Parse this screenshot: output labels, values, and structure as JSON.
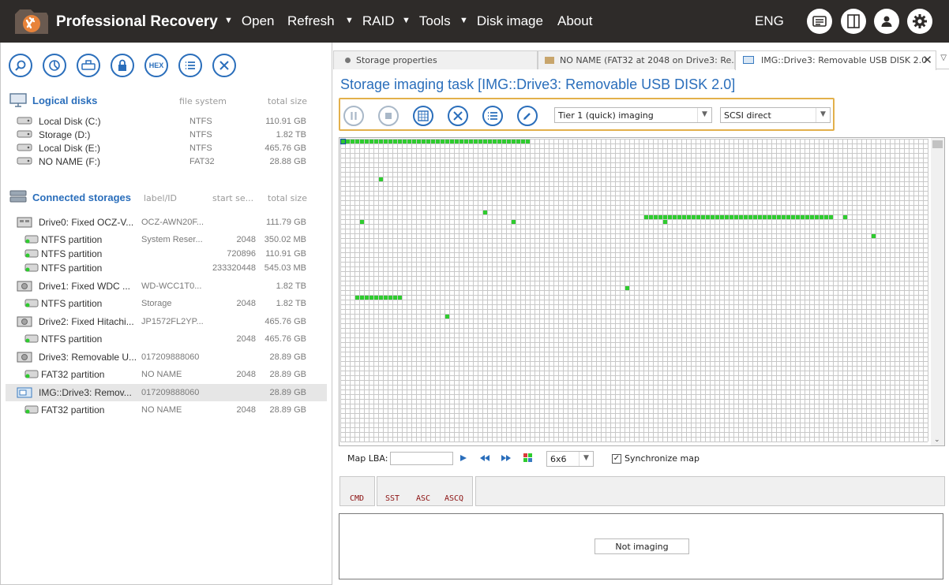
{
  "app": {
    "title": "Professional Recovery",
    "menu": [
      {
        "label": "Open",
        "has_arrow": true
      },
      {
        "label": "Refresh",
        "has_arrow": false
      },
      {
        "label": "RAID",
        "has_arrow": true
      },
      {
        "label": "Tools",
        "has_arrow": true
      },
      {
        "label": "Disk image",
        "has_arrow": true
      },
      {
        "label": "About",
        "has_arrow": false
      }
    ],
    "language": "ENG",
    "top_icons": [
      "log-icon",
      "panel-toggle-icon",
      "user-icon",
      "settings-icon"
    ]
  },
  "left_toolbar": {
    "buttons": [
      "search-icon",
      "scan-icon",
      "image-file-icon",
      "lock-icon",
      "hex-icon",
      "list-icon",
      "close-icon"
    ],
    "hex_label": "HEX"
  },
  "logical_disks": {
    "title": "Logical disks",
    "col_fs": "file system",
    "col_size": "total size",
    "items": [
      {
        "name": "Local Disk (C:)",
        "fs": "NTFS",
        "size": "110.91 GB"
      },
      {
        "name": "Storage (D:)",
        "fs": "NTFS",
        "size": "1.82 TB"
      },
      {
        "name": "Local Disk (E:)",
        "fs": "NTFS",
        "size": "465.76 GB"
      },
      {
        "name": "NO NAME (F:)",
        "fs": "FAT32",
        "size": "28.88 GB"
      }
    ]
  },
  "connected_storages": {
    "title": "Connected storages",
    "col_label": "label/ID",
    "col_start": "start se...",
    "col_size": "total size",
    "items": [
      {
        "kind": "drive",
        "icon": "ssd-icon",
        "name": "Drive0: Fixed OCZ-V...",
        "label": "OCZ-AWN20F...",
        "start": "",
        "size": "111.79 GB"
      },
      {
        "kind": "partition",
        "name": "NTFS partition",
        "label": "System Reser...",
        "start": "2048",
        "size": "350.02 MB"
      },
      {
        "kind": "partition",
        "name": "NTFS partition",
        "label": "",
        "start": "720896",
        "size": "110.91 GB"
      },
      {
        "kind": "partition",
        "name": "NTFS partition",
        "label": "",
        "start": "233320448",
        "size": "545.03 MB"
      },
      {
        "kind": "drive",
        "icon": "hdd-icon",
        "name": "Drive1: Fixed WDC ...",
        "label": "WD-WCC1T0...",
        "start": "",
        "size": "1.82 TB"
      },
      {
        "kind": "partition",
        "name": "NTFS partition",
        "label": "Storage",
        "start": "2048",
        "size": "1.82 TB"
      },
      {
        "kind": "drive",
        "icon": "hdd-icon",
        "name": "Drive2: Fixed Hitachi...",
        "label": "JP1572FL2YP...",
        "start": "",
        "size": "465.76 GB"
      },
      {
        "kind": "partition",
        "name": "NTFS partition",
        "label": "",
        "start": "2048",
        "size": "465.76 GB"
      },
      {
        "kind": "drive",
        "icon": "usb-drive-icon",
        "name": "Drive3: Removable U...",
        "label": "017209888060",
        "start": "",
        "size": "28.89 GB"
      },
      {
        "kind": "partition",
        "name": "FAT32 partition",
        "label": "NO NAME",
        "start": "2048",
        "size": "28.89 GB"
      },
      {
        "kind": "drive",
        "icon": "disk-image-icon",
        "name": "IMG::Drive3: Remov...",
        "label": "017209888060",
        "start": "",
        "size": "28.89 GB",
        "selected": true
      },
      {
        "kind": "partition",
        "name": "FAT32 partition",
        "label": "NO NAME",
        "start": "2048",
        "size": "28.89 GB"
      }
    ]
  },
  "tabs": [
    {
      "label": "Storage properties",
      "icon": "dot-icon"
    },
    {
      "label": "NO NAME (FAT32 at 2048 on Drive3: Re...",
      "icon": "folder-icon"
    },
    {
      "label": "IMG::Drive3: Removable USB DISK 2.0",
      "icon": "disk-image-icon",
      "active": true
    }
  ],
  "task": {
    "title": "Storage imaging task [IMG::Drive3: Removable USB DISK 2.0]",
    "tier_select": "Tier 1 (quick) imaging",
    "mode_select": "SCSI direct",
    "controls": [
      "pause-icon",
      "stop-icon",
      "map-icon",
      "cancel-icon",
      "list-icon",
      "edit-icon"
    ]
  },
  "map": {
    "cols": 124,
    "rows": 64,
    "colors": {
      "good": "#2ecc2e",
      "empty": "#ffffff",
      "grid": "#c8c8c8",
      "current": "#1a4fa0"
    },
    "filled_runs": [
      {
        "row": 0,
        "from": 0,
        "to": 39
      },
      {
        "row": 8,
        "from": 8,
        "to": 8
      },
      {
        "row": 15,
        "from": 30,
        "to": 30
      },
      {
        "row": 16,
        "from": 64,
        "to": 103
      },
      {
        "row": 16,
        "from": 106,
        "to": 106
      },
      {
        "row": 17,
        "from": 4,
        "to": 4
      },
      {
        "row": 17,
        "from": 36,
        "to": 36
      },
      {
        "row": 17,
        "from": 68,
        "to": 68
      },
      {
        "row": 20,
        "from": 112,
        "to": 112
      },
      {
        "row": 31,
        "from": 60,
        "to": 60
      },
      {
        "row": 33,
        "from": 3,
        "to": 12
      },
      {
        "row": 37,
        "from": 22,
        "to": 22
      }
    ]
  },
  "map_controls": {
    "lba_label": "Map LBA:",
    "lba_value": "",
    "block_size": "6x6",
    "sync_label": "Synchronize map",
    "sync_checked": true
  },
  "command_panel": {
    "cmd": "CMD",
    "sst": "SST",
    "asc": "ASC",
    "ascq": "ASCQ"
  },
  "status": {
    "text": "Not imaging"
  }
}
